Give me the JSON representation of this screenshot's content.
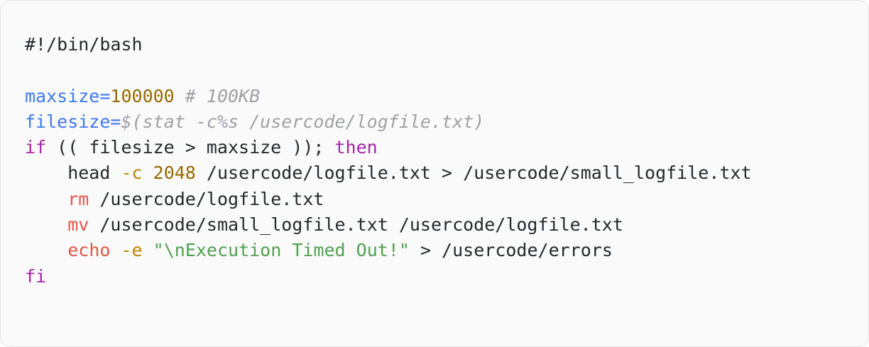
{
  "lines": [
    {
      "parts": [
        {
          "t": "#!/bin/bash",
          "c": "plain"
        }
      ]
    },
    {
      "parts": []
    },
    {
      "parts": [
        {
          "t": "maxsize",
          "c": "var"
        },
        {
          "t": "=",
          "c": "var"
        },
        {
          "t": "100000",
          "c": "num"
        },
        {
          "t": " ",
          "c": "plain"
        },
        {
          "t": "# 100KB",
          "c": "comment"
        }
      ]
    },
    {
      "parts": [
        {
          "t": "filesize",
          "c": "var"
        },
        {
          "t": "=",
          "c": "var"
        },
        {
          "t": "$(stat -c%s /usercode/logfile.txt)",
          "c": "comment"
        }
      ]
    },
    {
      "parts": [
        {
          "t": "if",
          "c": "kw"
        },
        {
          "t": " (( filesize > maxsize )); ",
          "c": "plain"
        },
        {
          "t": "then",
          "c": "kw"
        }
      ]
    },
    {
      "parts": [
        {
          "t": "    head ",
          "c": "plain"
        },
        {
          "t": "-c",
          "c": "flag"
        },
        {
          "t": " ",
          "c": "plain"
        },
        {
          "t": "2048",
          "c": "num"
        },
        {
          "t": " /usercode/logfile.txt > /usercode/small_logfile.txt",
          "c": "plain"
        }
      ]
    },
    {
      "parts": [
        {
          "t": "    ",
          "c": "plain"
        },
        {
          "t": "rm",
          "c": "cmd"
        },
        {
          "t": " /usercode/logfile.txt",
          "c": "plain"
        }
      ]
    },
    {
      "parts": [
        {
          "t": "    ",
          "c": "plain"
        },
        {
          "t": "mv",
          "c": "cmd"
        },
        {
          "t": " /usercode/small_logfile.txt /usercode/logfile.txt",
          "c": "plain"
        }
      ]
    },
    {
      "parts": [
        {
          "t": "    ",
          "c": "plain"
        },
        {
          "t": "echo",
          "c": "cmd"
        },
        {
          "t": " ",
          "c": "plain"
        },
        {
          "t": "-e",
          "c": "flag"
        },
        {
          "t": " ",
          "c": "plain"
        },
        {
          "t": "\"\\nExecution Timed Out!\"",
          "c": "str"
        },
        {
          "t": " > /usercode/errors",
          "c": "plain"
        }
      ]
    },
    {
      "parts": [
        {
          "t": "fi",
          "c": "kw"
        }
      ]
    }
  ],
  "colors": {
    "background": "#fafafa",
    "variable": "#4078f2",
    "number": "#986801",
    "comment": "#a0a1a7",
    "keyword": "#a626a4",
    "command": "#e45649",
    "flag": "#c18401",
    "string": "#50a14f",
    "text": "#24292e"
  }
}
